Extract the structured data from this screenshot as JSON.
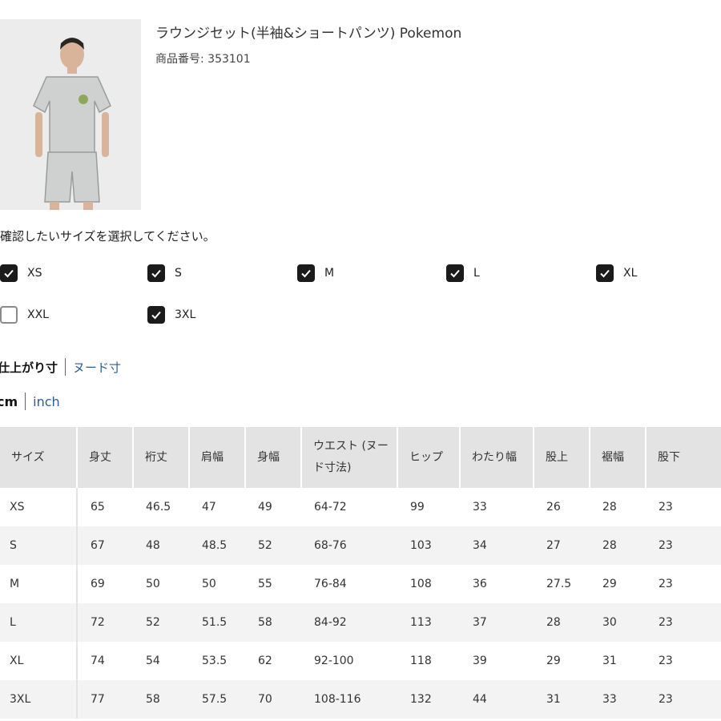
{
  "product": {
    "title": "ラウンジセット(半袖&ショートパンツ) Pokemon",
    "code": "商品番号: 353101"
  },
  "size_selector": {
    "prompt": "確認したいサイズを選択してください。",
    "options": [
      {
        "label": "XS",
        "checked": true
      },
      {
        "label": "S",
        "checked": true
      },
      {
        "label": "M",
        "checked": true
      },
      {
        "label": "L",
        "checked": true
      },
      {
        "label": "XL",
        "checked": true
      },
      {
        "label": "XXL",
        "checked": false
      },
      {
        "label": "3XL",
        "checked": true
      }
    ]
  },
  "measure_toggle": {
    "active": "仕上がり寸",
    "alternative": "ヌード寸"
  },
  "unit_toggle": {
    "active": "cm",
    "alternative": "inch"
  },
  "size_table": {
    "headers": [
      "サイズ",
      "身丈",
      "裄丈",
      "肩幅",
      "身幅",
      "ウエスト (ヌード寸法)",
      "ヒップ",
      "わたり幅",
      "股上",
      "裾幅",
      "股下"
    ],
    "rows": [
      [
        "XS",
        "65",
        "46.5",
        "47",
        "49",
        "64-72",
        "99",
        "33",
        "26",
        "28",
        "23"
      ],
      [
        "S",
        "67",
        "48",
        "48.5",
        "52",
        "68-76",
        "103",
        "34",
        "27",
        "28",
        "23"
      ],
      [
        "M",
        "69",
        "50",
        "50",
        "55",
        "76-84",
        "108",
        "36",
        "27.5",
        "29",
        "23"
      ],
      [
        "L",
        "72",
        "52",
        "51.5",
        "58",
        "84-92",
        "113",
        "37",
        "28",
        "30",
        "23"
      ],
      [
        "XL",
        "74",
        "54",
        "53.5",
        "62",
        "92-100",
        "118",
        "39",
        "29",
        "31",
        "23"
      ],
      [
        "3XL",
        "77",
        "58",
        "57.5",
        "70",
        "108-116",
        "132",
        "44",
        "31",
        "33",
        "23"
      ]
    ]
  },
  "colors": {
    "accent_link": "#2a5d9a",
    "checkbox_on": "#1b1b1b",
    "header_bg": "#e3e3e3"
  }
}
